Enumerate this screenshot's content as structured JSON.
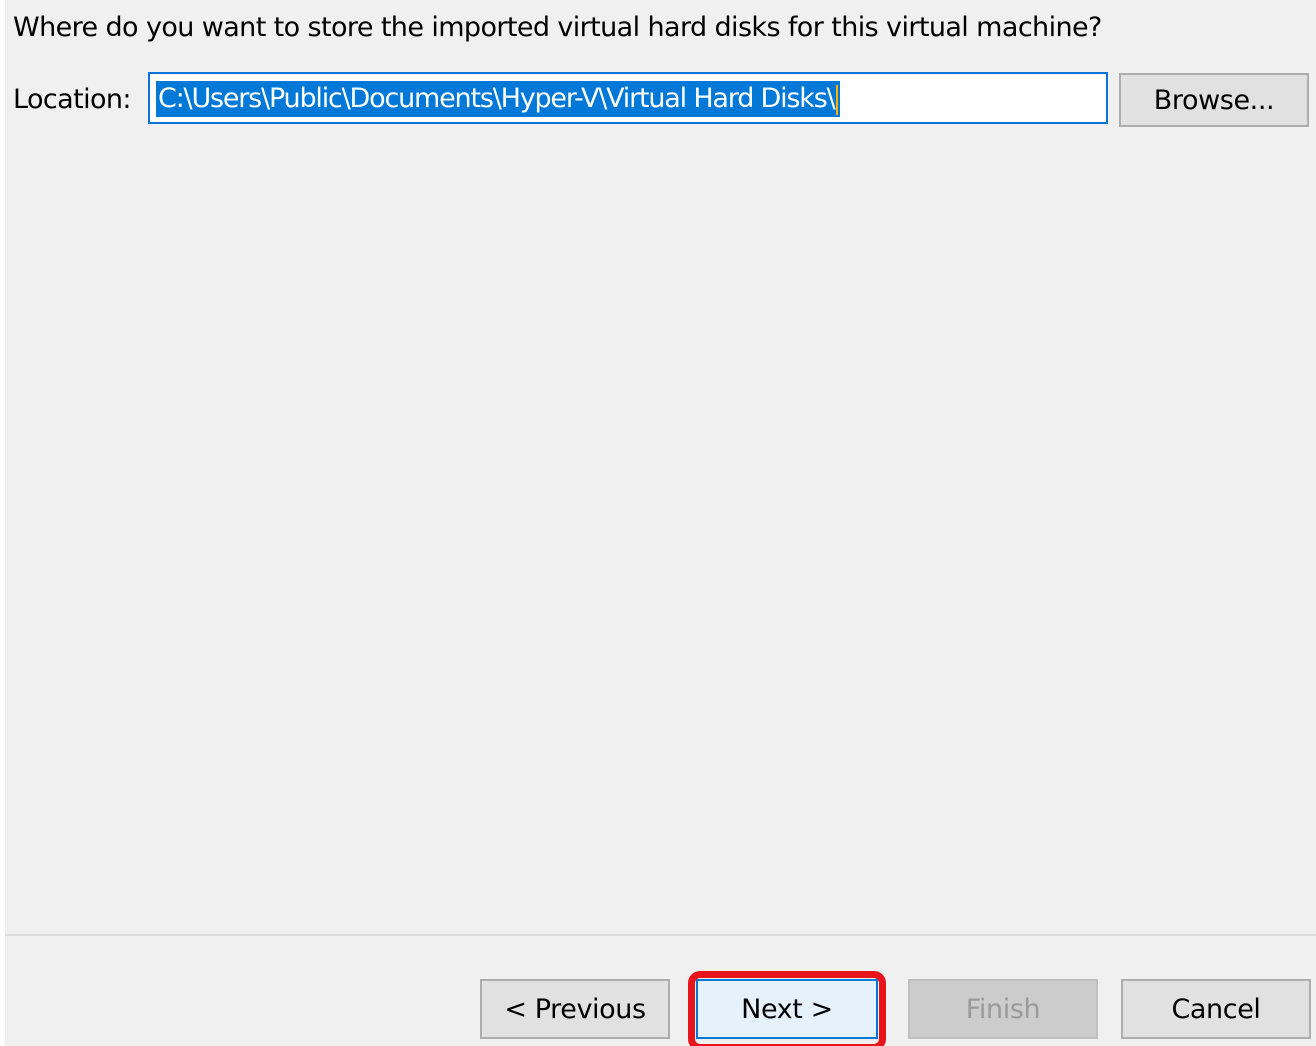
{
  "question": "Where do you want to store the imported virtual hard disks for this virtual machine?",
  "location": {
    "label": "Location:",
    "value": "C:\\Users\\Public\\Documents\\Hyper-V\\Virtual Hard Disks\\"
  },
  "buttons": {
    "browse": "Browse...",
    "previous": "< Previous",
    "next": "Next >",
    "finish": "Finish",
    "cancel": "Cancel"
  },
  "colors": {
    "selection": "#0078d7",
    "highlight": "#e8141b"
  }
}
